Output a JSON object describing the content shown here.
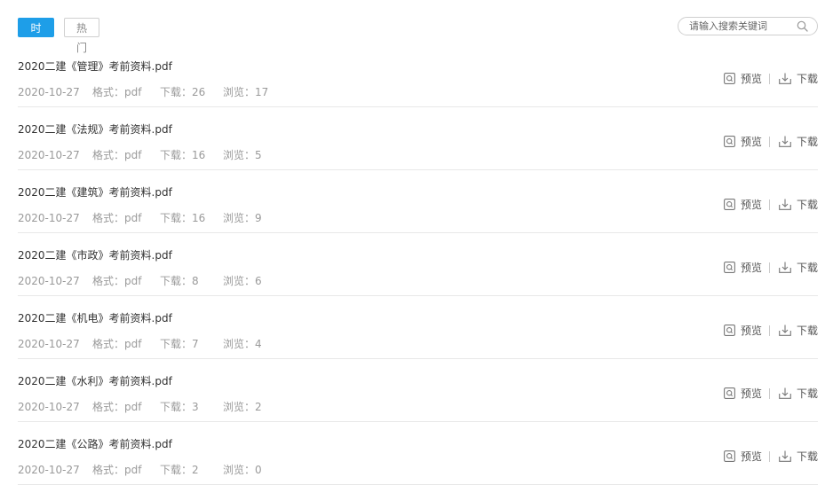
{
  "tabs": {
    "time_label": "时间",
    "hot_label": "热门"
  },
  "search": {
    "placeholder": "请输入搜索关键词"
  },
  "actions": {
    "preview_label": "预览",
    "download_label": "下载"
  },
  "files": [
    {
      "title": "2020二建《管理》考前资料.pdf",
      "date": "2020-10-27",
      "format": "格式：pdf",
      "downloads": "下载：26",
      "views": "浏览：17"
    },
    {
      "title": "2020二建《法规》考前资料.pdf",
      "date": "2020-10-27",
      "format": "格式：pdf",
      "downloads": "下载：16",
      "views": "浏览：5"
    },
    {
      "title": "2020二建《建筑》考前资料.pdf",
      "date": "2020-10-27",
      "format": "格式：pdf",
      "downloads": "下载：16",
      "views": "浏览：9"
    },
    {
      "title": "2020二建《市政》考前资料.pdf",
      "date": "2020-10-27",
      "format": "格式：pdf",
      "downloads": "下载：8",
      "views": "浏览：6"
    },
    {
      "title": "2020二建《机电》考前资料.pdf",
      "date": "2020-10-27",
      "format": "格式：pdf",
      "downloads": "下载：7",
      "views": "浏览：4"
    },
    {
      "title": "2020二建《水利》考前资料.pdf",
      "date": "2020-10-27",
      "format": "格式：pdf",
      "downloads": "下载：3",
      "views": "浏览：2"
    },
    {
      "title": "2020二建《公路》考前资料.pdf",
      "date": "2020-10-27",
      "format": "格式：pdf",
      "downloads": "下载：2",
      "views": "浏览：0"
    }
  ],
  "colors": {
    "accent": "#1e9ee8",
    "meta_text": "#9a9a9a",
    "divider": "#e8e8e8"
  }
}
